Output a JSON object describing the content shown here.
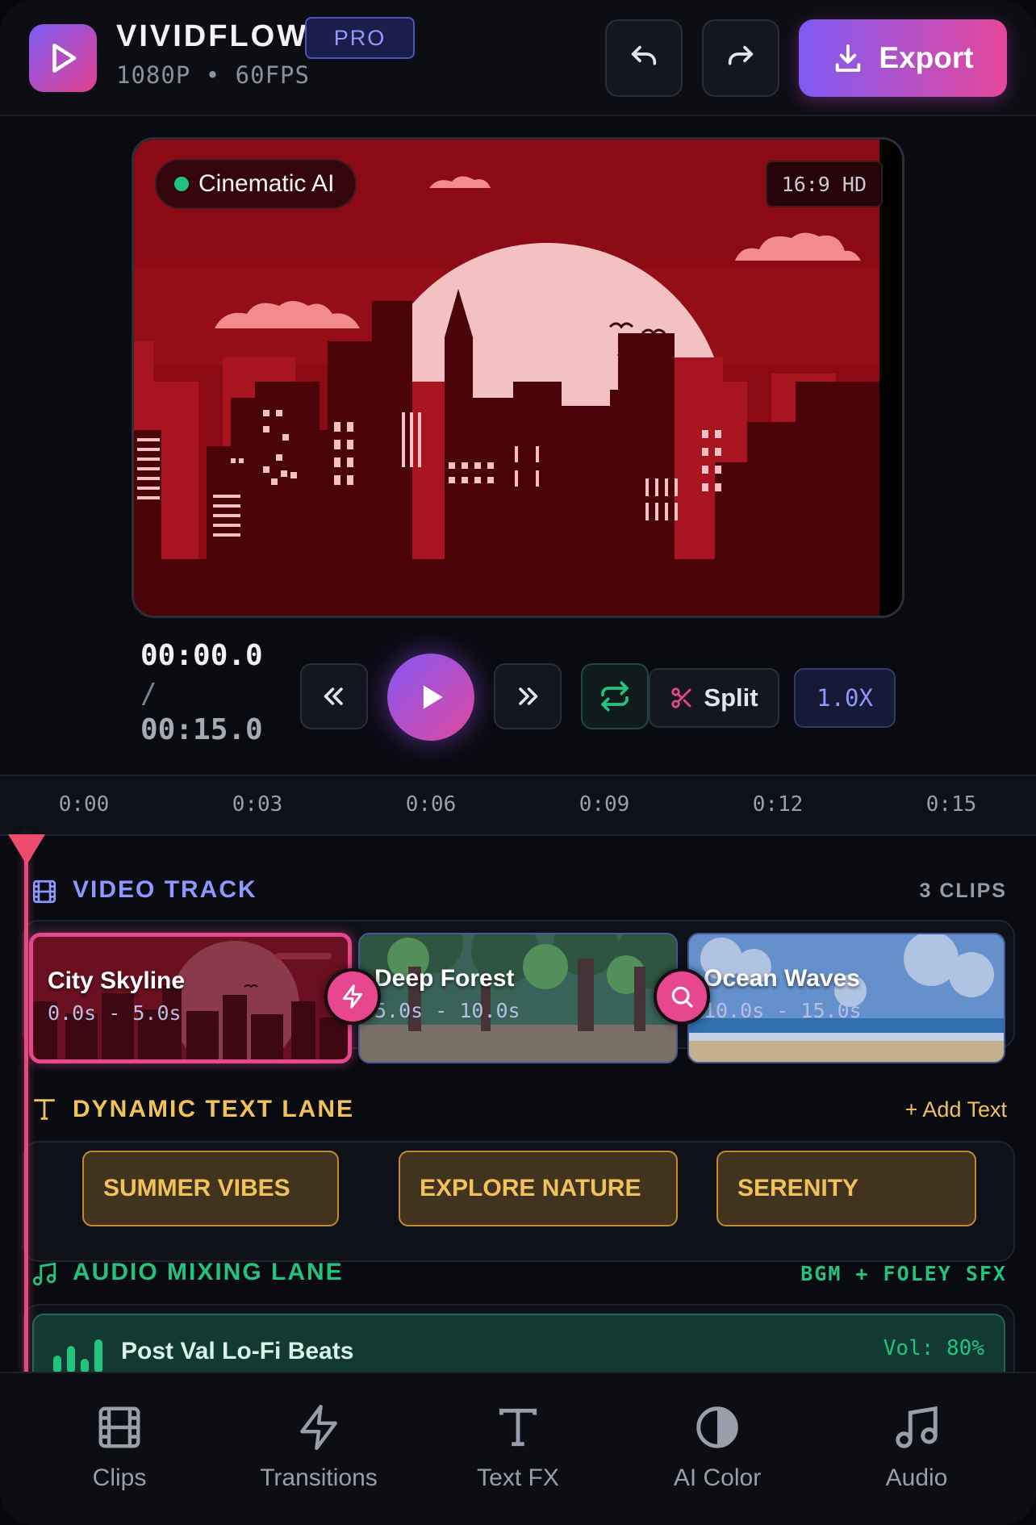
{
  "header": {
    "app_name": "VIVIDFLOW",
    "badge": "PRO",
    "resolution": "1080P • 60FPS",
    "export_label": "Export",
    "icons": [
      "play-logo-icon",
      "undo-icon",
      "redo-icon",
      "download-icon"
    ]
  },
  "preview": {
    "ai_badge": "Cinematic AI",
    "aspect": "16:9 HD",
    "colors": {
      "sky": "#8b0a14",
      "sun": "#f3c1c2",
      "buildings": "#a8141f",
      "foreground": "#4a0408"
    }
  },
  "playback": {
    "current_time": "00:00.0",
    "separator": "/",
    "total_time": "00:15.0",
    "split_label": "Split",
    "speed": "1.0X"
  },
  "ruler": {
    "ticks": [
      "0:00",
      "0:03",
      "0:06",
      "0:09",
      "0:12",
      "0:15"
    ]
  },
  "video_track": {
    "title": "VIDEO TRACK",
    "count": "3 CLIPS",
    "clips": [
      {
        "title": "City Skyline",
        "time": "0.0s - 5.0s",
        "selected": true
      },
      {
        "title": "Deep Forest",
        "time": "5.0s - 10.0s",
        "selected": false
      },
      {
        "title": "Ocean Waves",
        "time": "10.0s - 15.0s",
        "selected": false
      }
    ],
    "transitions": [
      "lightning-icon",
      "zoom-icon"
    ]
  },
  "text_lane": {
    "title": "DYNAMIC TEXT LANE",
    "action": "+ Add Text",
    "chips": [
      "SUMMER VIBES",
      "EXPLORE NATURE",
      "SERENITY"
    ]
  },
  "audio_lane": {
    "title": "AUDIO MIXING LANE",
    "subtitle": "BGM + FOLEY SFX",
    "clip": {
      "name": "Post Val Lo-Fi Beats",
      "volume": "Vol: 80%"
    }
  },
  "nav": {
    "items": [
      {
        "label": "Clips",
        "icon": "film-icon"
      },
      {
        "label": "Transitions",
        "icon": "lightning-icon"
      },
      {
        "label": "Text FX",
        "icon": "text-icon"
      },
      {
        "label": "AI Color",
        "icon": "contrast-icon"
      },
      {
        "label": "Audio",
        "icon": "music-icon"
      }
    ]
  },
  "accent_colors": {
    "primary": "#7f5bf5",
    "pink": "#e5479a",
    "green": "#22c37d",
    "amber": "#f2c25a",
    "indigo": "#8d98ff"
  }
}
